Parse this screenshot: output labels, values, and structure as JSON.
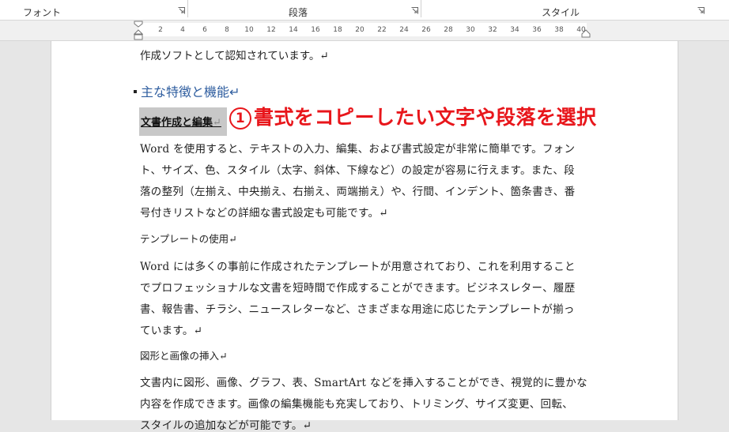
{
  "ribbon": {
    "groups": [
      {
        "label": "フォント"
      },
      {
        "label": "段落"
      },
      {
        "label": "スタイル"
      }
    ]
  },
  "ruler": {
    "ticks": [
      "2",
      "4",
      "6",
      "8",
      "10",
      "12",
      "14",
      "16",
      "18",
      "20",
      "22",
      "24",
      "26",
      "28",
      "30",
      "32",
      "34",
      "36",
      "38",
      "40"
    ]
  },
  "document": {
    "line_top": "作成ソフトとして認知されています。↵",
    "heading2": "主な特徴と機能↵",
    "heading3_selected": "文書作成と編集",
    "heading3_mark": "↵",
    "annotation": "書式をコピーしたい文字や段落を選択",
    "annotation_number": "1",
    "para1": [
      "Word を使用すると、テキストの入力、編集、および書式設定が非常に簡単です。フォン",
      "ト、サイズ、色、スタイル（太字、斜体、下線など）の設定が容易に行えます。また、段",
      "落の整列（左揃え、中央揃え、右揃え、両端揃え）や、行間、インデント、箇条書き、番",
      "号付きリストなどの詳細な書式設定も可能です。↵"
    ],
    "subhead2": "テンプレートの使用↵",
    "para2": [
      "Word には多くの事前に作成されたテンプレートが用意されており、これを利用すること",
      "でプロフェッショナルな文書を短時間で作成することができます。ビジネスレター、履歴",
      "書、報告書、チラシ、ニュースレターなど、さまざまな用途に応じたテンプレートが揃っ",
      "ています。↵"
    ],
    "subhead3": "図形と画像の挿入↵",
    "para3": [
      "文書内に図形、画像、グラフ、表、SmartArt などを挿入することができ、視覚的に豊かな",
      "内容を作成できます。画像の編集機能も充実しており、トリミング、サイズ変更、回転、",
      "スタイルの追加などが可能です。↵"
    ]
  },
  "colors": {
    "heading_blue": "#2e5d9f",
    "annotation_red": "#e8161b",
    "selection_gray": "#c8c8c8"
  }
}
